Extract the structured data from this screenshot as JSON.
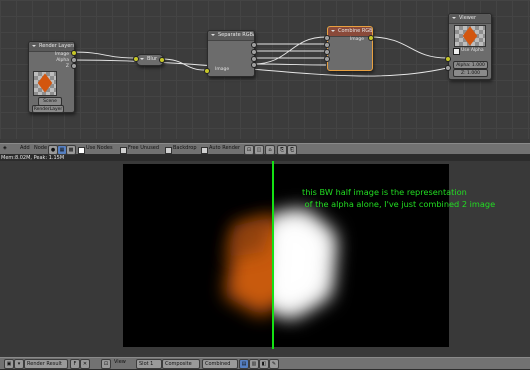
{
  "node_editor": {
    "render_layers": {
      "title": "Render Layers",
      "outputs": [
        "Image",
        "Alpha",
        "Z"
      ],
      "scene": "Scene",
      "layer": "RenderLayer"
    },
    "blur": {
      "title": "Blur"
    },
    "separate": {
      "title": "Separate RGBA",
      "input": "Image"
    },
    "combine": {
      "title": "Combine RGBA",
      "output": "Image"
    },
    "viewer": {
      "title": "Viewer",
      "use_alpha": "Use Alpha",
      "alpha_field": "Alpha: 1.000",
      "z_field": "Z: 1.000"
    }
  },
  "node_header": {
    "menus": [
      "Add",
      "Node"
    ],
    "use_nodes": "Use Nodes",
    "free_unused": "Free Unused",
    "backdrop": "Backdrop",
    "auto_render": "Auto Render"
  },
  "image_info": "Mem:8.02M, Peak: 1.15M",
  "annotation": "this BW half image is the representation\n of the alpha alone, I've just combined 2 image",
  "image_footer": {
    "image_name": "Render Result",
    "view": "View",
    "slot": "Slot 1",
    "layer": "Composite",
    "pass": "Combined"
  },
  "colors": {
    "socket_yellow": "#c7c729",
    "link": "#e6e6e6",
    "annotation_green": "#22dd22",
    "render_orange": "#d3560f",
    "selected_node_border": "#e8a040"
  }
}
